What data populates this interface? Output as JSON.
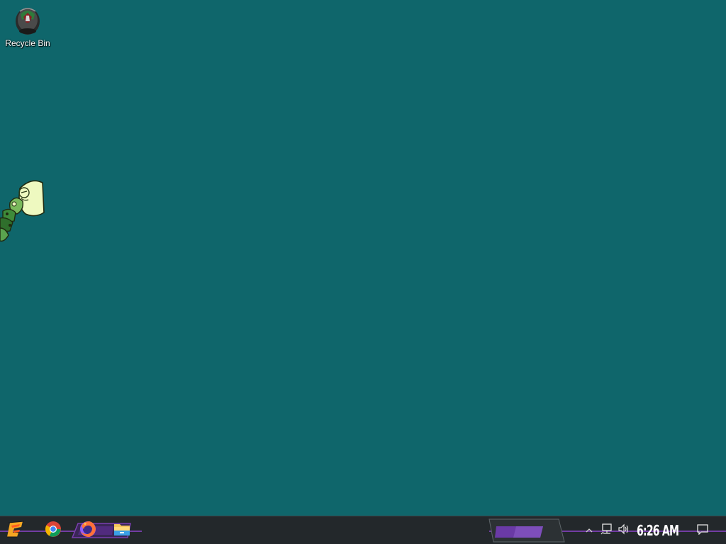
{
  "desktop": {
    "background": "#0f666b",
    "icons": [
      {
        "label": "Recycle Bin",
        "icon": "recycle-bin-icon"
      }
    ],
    "mascot": "peridot-character"
  },
  "taskbar": {
    "accent": "#7b3fb0",
    "start": {
      "icon": "start-logo-icon"
    },
    "pinned": [
      {
        "icon": "chrome-icon"
      },
      {
        "icon": "firefox-icon"
      },
      {
        "icon": "file-explorer-icon"
      }
    ],
    "tray": {
      "overflow_icon": "chevron-up-icon",
      "network_icon": "network-icon",
      "volume_icon": "volume-icon",
      "time": "6:26 AM",
      "action_center_icon": "notification-icon"
    }
  }
}
